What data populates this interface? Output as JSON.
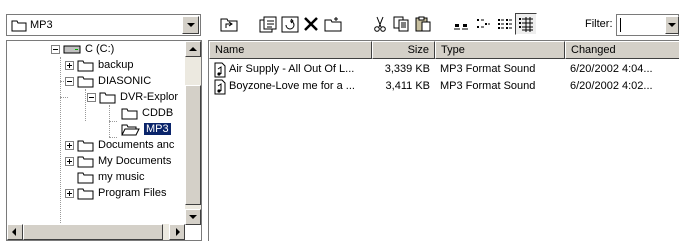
{
  "location": {
    "value": "MP3",
    "icon": "folder-icon"
  },
  "toolbar": {
    "buttons": [
      {
        "name": "up-one-level-button",
        "icon": "up-folder-icon"
      },
      {
        "name": "properties-button",
        "icon": "properties-icon"
      },
      {
        "name": "refresh-button",
        "icon": "refresh-icon"
      },
      {
        "name": "delete-button",
        "icon": "delete-x-icon"
      },
      {
        "name": "new-folder-button",
        "icon": "new-folder-icon"
      },
      {
        "name": "cut-button",
        "icon": "scissors-icon"
      },
      {
        "name": "copy-button",
        "icon": "copy-icon"
      },
      {
        "name": "paste-button",
        "icon": "paste-icon"
      },
      {
        "name": "large-icons-view-button",
        "icon": "large-icons-icon"
      },
      {
        "name": "small-icons-view-button",
        "icon": "small-icons-icon"
      },
      {
        "name": "list-view-button",
        "icon": "list-view-icon"
      },
      {
        "name": "details-view-button",
        "icon": "details-view-icon"
      }
    ],
    "filter_label": "Filter:",
    "filter_value": ""
  },
  "tree": {
    "items": [
      {
        "label": "C (C:)",
        "icon": "drive-icon",
        "expander": "minus"
      },
      {
        "label": "backup",
        "icon": "folder-icon",
        "expander": "plus"
      },
      {
        "label": "DIASONIC",
        "icon": "folder-icon",
        "expander": "minus"
      },
      {
        "label": "DVR-Explor",
        "icon": "folder-icon",
        "expander": "minus"
      },
      {
        "label": "CDDB",
        "icon": "folder-icon",
        "expander": "none"
      },
      {
        "label": "MP3",
        "icon": "open-folder-icon",
        "expander": "none",
        "selected": true
      },
      {
        "label": "Documents anc",
        "icon": "folder-icon",
        "expander": "plus"
      },
      {
        "label": "My Documents",
        "icon": "folder-icon",
        "expander": "plus"
      },
      {
        "label": "my music",
        "icon": "folder-icon",
        "expander": "none"
      },
      {
        "label": "Program Files",
        "icon": "folder-icon",
        "expander": "plus"
      }
    ]
  },
  "list": {
    "columns": [
      "Name",
      "Size",
      "Type",
      "Changed"
    ],
    "rows": [
      {
        "name": "Air Supply - All Out Of L...",
        "size": "3,339 KB",
        "type": "MP3 Format Sound",
        "changed": "6/20/2002 4:04..."
      },
      {
        "name": "Boyzone-Love me for a ...",
        "size": "3,411 KB",
        "type": "MP3 Format Sound",
        "changed": "6/20/2002 4:02..."
      }
    ]
  },
  "colors": {
    "selection": "#0a246a",
    "chrome": "#d4d0c8"
  }
}
